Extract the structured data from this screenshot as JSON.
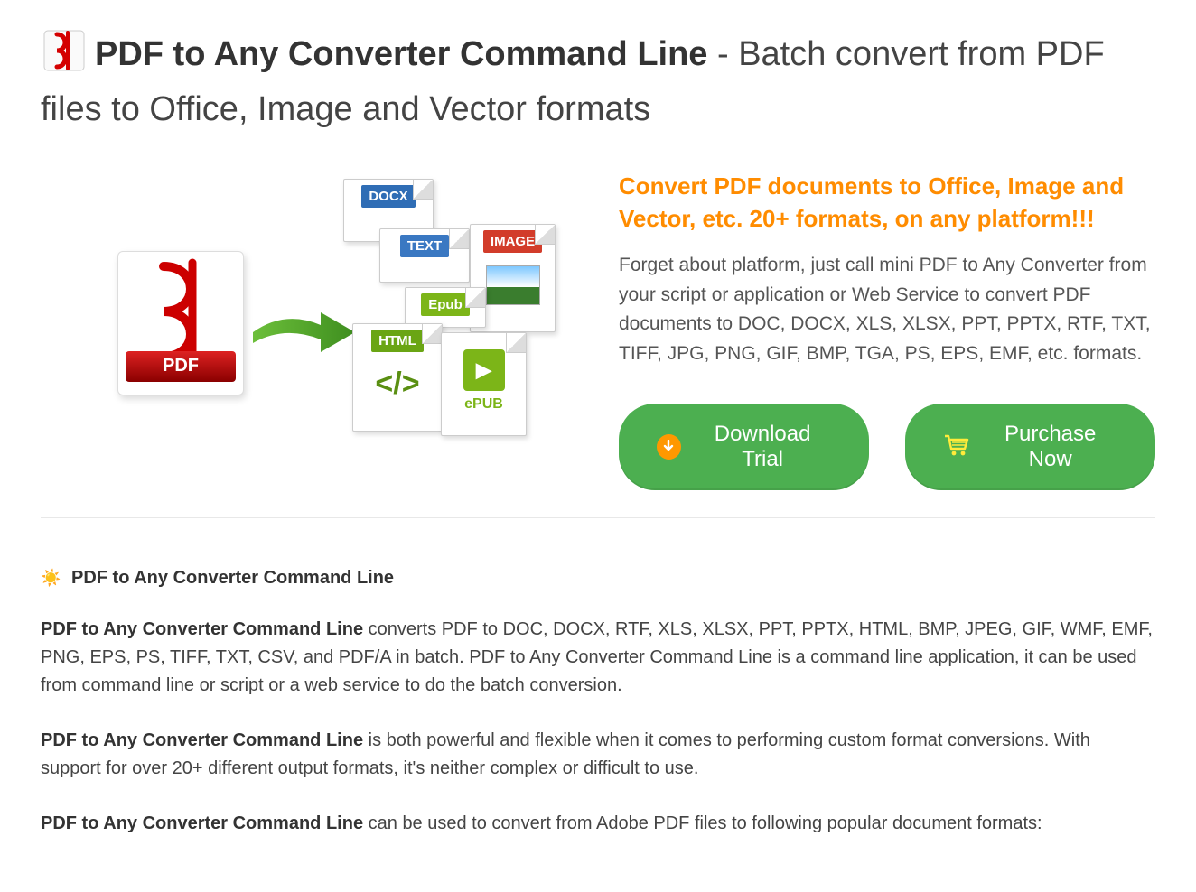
{
  "title": {
    "bold": "PDF to Any Converter Command Line",
    "rest": " - Batch convert from PDF files to Office, Image and Vector formats"
  },
  "hero": {
    "headline": "Convert PDF documents to Office, Image and Vector, etc. 20+ formats, on any platform!!!",
    "subtext": "Forget about platform, just call mini PDF to Any Converter from your script or application or Web Service to convert PDF documents to DOC, DOCX, XLS, XLSX, PPT, PPTX, RTF, TXT, TIFF, JPG, PNG, GIF, BMP, TGA, PS, EPS, EMF, etc. formats.",
    "graphic": {
      "source_label": "PDF",
      "targets": [
        "DOCX",
        "TEXT",
        "IMAGE",
        "Epub",
        "HTML",
        "ePUB"
      ]
    }
  },
  "buttons": {
    "download": "Download Trial",
    "purchase": "Purchase Now"
  },
  "section": {
    "heading": "PDF to Any Converter Command Line",
    "para1_bold": "PDF to Any Converter Command Line",
    "para1_rest": " converts PDF to DOC, DOCX, RTF, XLS, XLSX, PPT, PPTX, HTML, BMP, JPEG, GIF, WMF, EMF, PNG, EPS, PS, TIFF, TXT, CSV, and PDF/A in batch. PDF to Any Converter Command Line is a command line application, it can be used from command line or script or a web service to do the batch conversion.",
    "para2_bold": "PDF to Any Converter Command Line",
    "para2_rest": " is both powerful and flexible when it comes to performing custom format conversions. With support for over 20+ different output formats, it's neither complex or difficult to use.",
    "para3_bold": "PDF to Any Converter Command Line",
    "para3_rest": " can be used to convert from Adobe PDF files to following popular document formats:"
  }
}
